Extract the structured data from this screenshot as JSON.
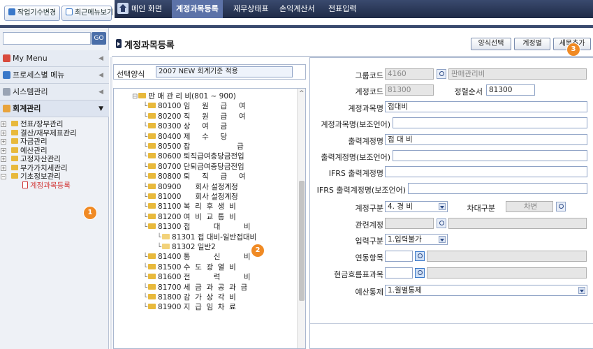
{
  "topbar": {
    "btn_task_change": "작업기수변경",
    "btn_recent_menu": "최근메뉴보기",
    "menu_tabs": [
      "메인 화면",
      "계정과목등록",
      "재무상태표",
      "손익계산서",
      "전표입력"
    ],
    "active_tab": "계정과목등록"
  },
  "sidebar": {
    "go_label": "GO",
    "sections": [
      {
        "label": "My Menu",
        "color": "#d84a3c"
      },
      {
        "label": "프로세스별 메뉴",
        "color": "#3a78c9"
      },
      {
        "label": "시스템관리",
        "color": "#9aa4b4"
      },
      {
        "label": "회계관리",
        "color": "#e8a33c"
      }
    ],
    "tree": [
      {
        "label": "전표/장부관리"
      },
      {
        "label": "결산/재무제표관리"
      },
      {
        "label": "자금관리"
      },
      {
        "label": "예산관리"
      },
      {
        "label": "고정자산관리"
      },
      {
        "label": "부가가치세관리"
      },
      {
        "label": "기초정보관리"
      }
    ],
    "active_item": "계정과목등록",
    "badge_1": "1"
  },
  "header": {
    "title": "계정과목등록",
    "btn_form_select": "양식선택",
    "btn_account_by": "계정별",
    "btn_add_detail": "세목추가",
    "badge_3": "3"
  },
  "mid": {
    "form_type_label": "선택양식",
    "form_type_value": "2007 NEW 회계기준 적용",
    "badge_2": "2",
    "tree": [
      {
        "text": "판 매 관 리 비(801 ~ 900)",
        "level": 0,
        "selected": false
      },
      {
        "text": "80100 임     원     급     여",
        "level": 1
      },
      {
        "text": "80200 직     원     급     여",
        "level": 1
      },
      {
        "text": "80300 상     여     금",
        "level": 1
      },
      {
        "text": "80400 제     수     당",
        "level": 1
      },
      {
        "text": "80500 잡                    급",
        "level": 1
      },
      {
        "text": "80600 퇴직급여충당금전입",
        "level": 1
      },
      {
        "text": "80700 단퇴급여충당금전입",
        "level": 1
      },
      {
        "text": "80800 퇴     직     급     여",
        "level": 1
      },
      {
        "text": "80900      회사 설정계정",
        "level": 1
      },
      {
        "text": "81000      회사 설정계정",
        "level": 1
      },
      {
        "text": "81100 복  리  후  생  비",
        "level": 1
      },
      {
        "text": "81200 여  비  교  통  비",
        "level": 1
      },
      {
        "text": "81300 접          대          비",
        "level": 1
      },
      {
        "text": "81301 접 대비-일반접대비",
        "level": 2
      },
      {
        "text": "81302 일반2",
        "level": 2
      },
      {
        "text": "81400 통          신          비",
        "level": 1
      },
      {
        "text": "81500 수  도  광  열  비",
        "level": 1
      },
      {
        "text": "81600 전          력          비",
        "level": 1
      },
      {
        "text": "81700 세  금  과  공  과  금",
        "level": 1
      },
      {
        "text": "81800 감  가  상  각  비",
        "level": 1
      },
      {
        "text": "81900 지  급  임  차  료",
        "level": 1
      }
    ]
  },
  "form": {
    "group_code_label": "그룹코드",
    "group_code_value": "4160",
    "group_name_value": "판매관리비",
    "account_code_label": "계정코드",
    "account_code_value": "81300",
    "sort_order_label": "정렬순서",
    "sort_order_value": "81300",
    "account_name_label": "계정과목명",
    "account_name_value": "접대비",
    "account_name_sub_label": "계정과목명(보조언어)",
    "account_name_sub_value": "",
    "print_name_label": "출력계정명",
    "print_name_value": "접          대          비",
    "print_name_sub_label": "출력계정명(보조언어)",
    "print_name_sub_value": "",
    "ifrs_print_label": "IFRS 출력계정명",
    "ifrs_print_value": "",
    "ifrs_print_sub_label": "IFRS 출력계정명(보조언어)",
    "ifrs_print_sub_value": "",
    "account_type_label": "계정구분",
    "account_type_value": "4. 경     비",
    "dr_cr_label": "차대구분",
    "dr_cr_value": "차변",
    "related_account_label": "관련계정",
    "input_type_label": "입력구분",
    "input_type_value": "1.입력불가",
    "linked_item_label": "연동항목",
    "cash_flow_label": "현금흐름표과목",
    "budget_control_label": "예산통제",
    "budget_control_value": "1.월별통제"
  }
}
